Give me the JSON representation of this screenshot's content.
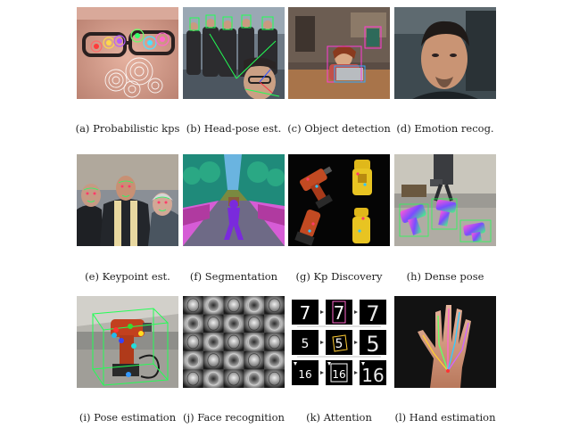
{
  "figure": {
    "panels": [
      {
        "id": "a",
        "caption": "(a) Probabilistic kps"
      },
      {
        "id": "b",
        "caption": "(b) Head-pose est."
      },
      {
        "id": "c",
        "caption": "(c) Object detection"
      },
      {
        "id": "d",
        "caption": "(d) Emotion recog."
      },
      {
        "id": "e",
        "caption": "(e) Keypoint est."
      },
      {
        "id": "f",
        "caption": "(f) Segmentation"
      },
      {
        "id": "g",
        "caption": "(g) Kp Discovery"
      },
      {
        "id": "h",
        "caption": "(h) Dense pose"
      },
      {
        "id": "i",
        "caption": "(i) Pose estimation"
      },
      {
        "id": "j",
        "caption": "(j) Face recognition"
      },
      {
        "id": "k",
        "caption": "(k) Attention"
      },
      {
        "id": "l",
        "caption": "(l) Hand estimation"
      }
    ],
    "digits": {
      "row1": "7",
      "row2": "5",
      "row3": "16"
    }
  }
}
